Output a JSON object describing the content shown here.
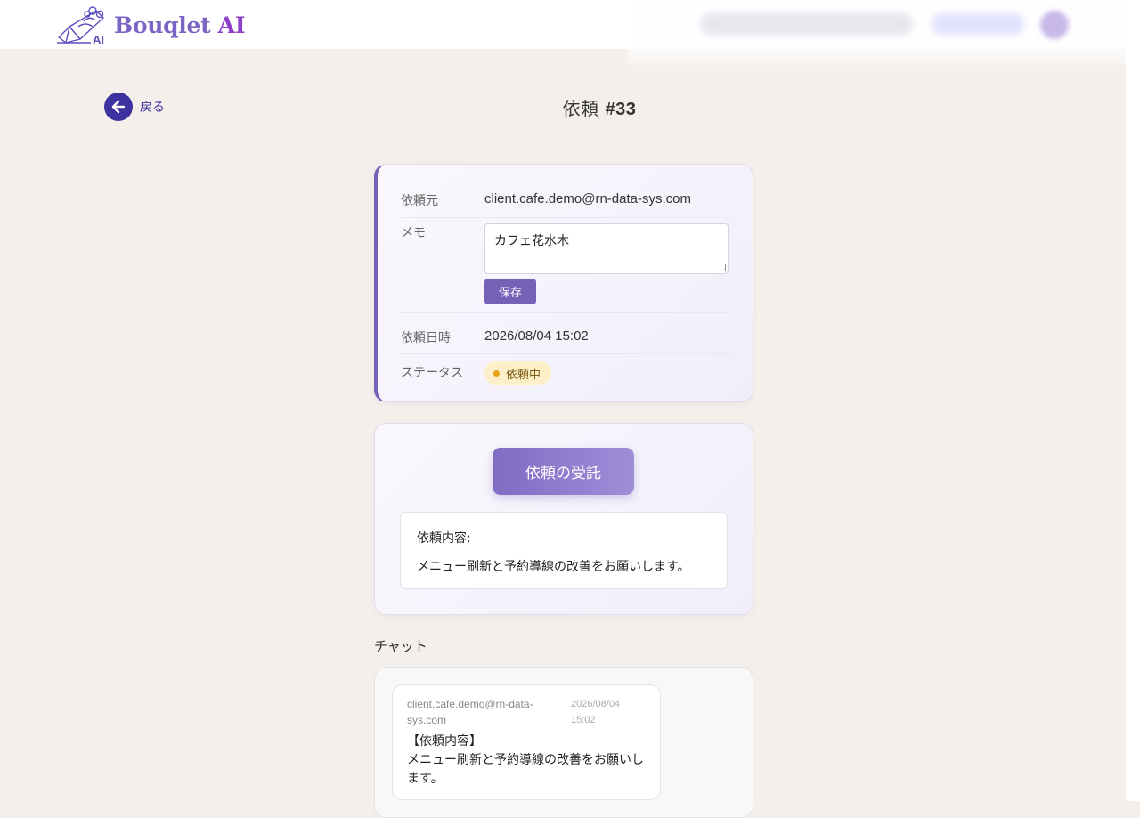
{
  "brand": {
    "name": "Bouqlet",
    "suffix": "AI",
    "mark_text": "AI"
  },
  "nav": {
    "back_label": "戻る"
  },
  "page": {
    "title_prefix": "依頼",
    "title_number": "#33"
  },
  "request": {
    "client_label": "依頼元",
    "client_value": "client.cafe.demo@rn-data-sys.com",
    "memo_label": "メモ",
    "memo_value": "カフェ花水木",
    "save_label": "保存",
    "date_label": "依頼日時",
    "date_value": "2026/08/04 15:02",
    "status_label": "ステータス",
    "status_value": "依頼中"
  },
  "accept": {
    "button_label": "依頼の受託",
    "content_title": "依頼内容:",
    "content_body": "メニュー刷新と予約導線の改善をお願いします。"
  },
  "chat": {
    "label": "チャット",
    "messages": [
      {
        "sender": "client.cafe.demo@rn-data-sys.com",
        "time": "2026/08/04 15:02",
        "heading": "【依頼内容】",
        "body": "メニュー刷新と予約導線の改善をお願いします。"
      }
    ]
  },
  "colors": {
    "brand": "#7a64c4",
    "accent": "#3d31a0",
    "primary_button": "#7561b6",
    "status_pending_bg": "#fdf0c8",
    "status_pending_dot": "#e7a21a",
    "page_bg": "#f4efea"
  },
  "icons": {
    "logo": "bouquet-icon",
    "back": "arrow-left-icon",
    "status": "dot-icon"
  }
}
